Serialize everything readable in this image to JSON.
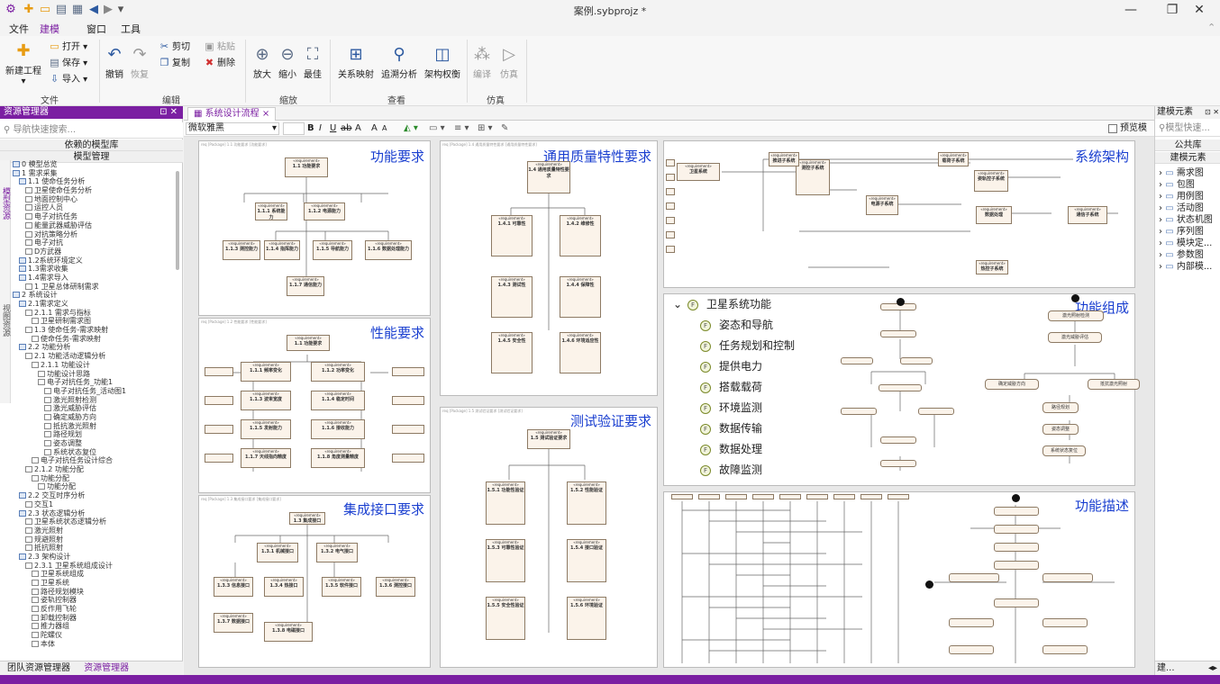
{
  "window": {
    "title": "案例.sybprojz *",
    "minimize": "—",
    "restore": "❐",
    "close": "✕"
  },
  "quickaccess": [
    "⚙",
    "✚",
    "▭",
    "▤",
    "▦",
    "◀",
    "▶",
    "▾"
  ],
  "menu": {
    "items": [
      "文件",
      "建模",
      "窗口",
      "工具"
    ],
    "active": "建模"
  },
  "ribbon": {
    "file_group": {
      "label": "文件",
      "new": "新建工程",
      "open": "打开",
      "save": "保存",
      "import": "导入"
    },
    "edit_group": {
      "label": "编辑",
      "undo": "撤销",
      "redo": "恢复",
      "cut": "剪切",
      "copy": "复制",
      "paste": "粘贴",
      "delete": "删除"
    },
    "zoom_group": {
      "label": "缩放",
      "zoomin": "放大",
      "zoomout": "缩小",
      "fit": "最佳"
    },
    "view_group": {
      "label": "查看",
      "relmap": "关系映射",
      "trace": "追溯分析",
      "tradeoff": "架构权衡"
    },
    "sim_group": {
      "label": "仿真",
      "compile": "编译",
      "simulate": "仿真"
    }
  },
  "left": {
    "title": "资源管理器",
    "search_placeholder": "导航快速搜索...",
    "header1": "依赖的模型库",
    "header2": "模型管理",
    "vtabs": [
      "模型资源",
      "视图资源"
    ],
    "tree": [
      {
        "d": 0,
        "t": "0 模型总览"
      },
      {
        "d": 0,
        "t": "1 需求采集"
      },
      {
        "d": 1,
        "t": "1.1 使命任务分析"
      },
      {
        "d": 2,
        "t": "卫星使命任务分析"
      },
      {
        "d": 2,
        "t": "地面控制中心"
      },
      {
        "d": 2,
        "t": "运控人员"
      },
      {
        "d": 2,
        "t": "电子对抗任务"
      },
      {
        "d": 2,
        "t": "能量武器威胁评估"
      },
      {
        "d": 2,
        "t": "对抗策略分析"
      },
      {
        "d": 2,
        "t": "电子对抗"
      },
      {
        "d": 2,
        "t": "D方武器"
      },
      {
        "d": 1,
        "t": "1.2系统环境定义"
      },
      {
        "d": 1,
        "t": "1.3需求收集"
      },
      {
        "d": 1,
        "t": "1.4需求导入"
      },
      {
        "d": 2,
        "t": "1 卫星总体研制需求"
      },
      {
        "d": 0,
        "t": "2 系统设计"
      },
      {
        "d": 1,
        "t": "2.1需求定义"
      },
      {
        "d": 2,
        "t": "2.1.1 需求与指标"
      },
      {
        "d": 3,
        "t": "卫星研制需求图"
      },
      {
        "d": 2,
        "t": "1.3 使命任务-需求映射"
      },
      {
        "d": 3,
        "t": "使命任务-需求映射"
      },
      {
        "d": 1,
        "t": "2.2 功能分析"
      },
      {
        "d": 2,
        "t": "2.1 功能活动逻辑分析"
      },
      {
        "d": 3,
        "t": "2.1.1 功能设计"
      },
      {
        "d": 4,
        "t": "功能设计思路"
      },
      {
        "d": 4,
        "t": "电子对抗任务_功能1"
      },
      {
        "d": 5,
        "t": "电子对抗任务_活动图1"
      },
      {
        "d": 5,
        "t": "激光照射检测"
      },
      {
        "d": 5,
        "t": "激光威胁评估"
      },
      {
        "d": 5,
        "t": "确定威胁方向"
      },
      {
        "d": 5,
        "t": "抵抗激光照射"
      },
      {
        "d": 5,
        "t": "路径规划"
      },
      {
        "d": 5,
        "t": "姿态调整"
      },
      {
        "d": 5,
        "t": "系统状态复位"
      },
      {
        "d": 3,
        "t": "电子对抗任务设计综合"
      },
      {
        "d": 2,
        "t": "2.1.2 功能分配"
      },
      {
        "d": 3,
        "t": "功能分配"
      },
      {
        "d": 4,
        "t": "功能分配"
      },
      {
        "d": 1,
        "t": "2.2 交互时序分析"
      },
      {
        "d": 2,
        "t": "交互1"
      },
      {
        "d": 1,
        "t": "2.3 状态逻辑分析"
      },
      {
        "d": 2,
        "t": "卫星系统状态逻辑分析"
      },
      {
        "d": 2,
        "t": "激光照射"
      },
      {
        "d": 2,
        "t": "规避照射"
      },
      {
        "d": 2,
        "t": "抵抗照射"
      },
      {
        "d": 1,
        "t": "2.3 架构设计"
      },
      {
        "d": 2,
        "t": "2.3.1 卫星系统组成设计"
      },
      {
        "d": 3,
        "t": "卫星系统组成"
      },
      {
        "d": 3,
        "t": "卫星系统"
      },
      {
        "d": 3,
        "t": "路径规划模块"
      },
      {
        "d": 3,
        "t": "姿轨控制器"
      },
      {
        "d": 3,
        "t": "反作用飞轮"
      },
      {
        "d": 3,
        "t": "卸载控制器"
      },
      {
        "d": 3,
        "t": "推力器组"
      },
      {
        "d": 3,
        "t": "陀螺仪"
      },
      {
        "d": 3,
        "t": "本体"
      }
    ],
    "bottom_tabs": [
      "团队资源管理器",
      "资源管理器"
    ]
  },
  "doc": {
    "tab": "系统设计流程",
    "font": "微软雅黑",
    "fmt": [
      "B",
      "I",
      "U",
      "ab",
      "A",
      "A",
      "A"
    ],
    "preview": "预览模式",
    "frames": {
      "f1": {
        "label": "功能要求",
        "hdr": "req [Package] 1.1 功能要求 [功能要求]"
      },
      "f2": {
        "label": "性能要求",
        "hdr": "req [Package] 1.2 性能要求 [性能要求]"
      },
      "f3": {
        "label": "集成接口要求",
        "hdr": "req [Package] 1.3 集成接口要求 [集成接口要求]"
      },
      "f4": {
        "label": "通用质量特性要求",
        "hdr": "req [Package] 1.4 通用质量特性要求 [通用质量特性要求]"
      },
      "f5": {
        "label": "测试验证要求",
        "hdr": "req [Package] 1.5 测试验证要求 [测试验证要求]"
      },
      "f6": {
        "label": "系统架构"
      },
      "f7": {
        "label": "功能组成"
      },
      "f8": {
        "label": "功能描述"
      }
    },
    "boxes_f1": [
      "1.1 功能要求",
      "1.1.1 系统能力",
      "1.1.2 电源能力",
      "1.1.3 测控能力",
      "1.1.4 指挥能力",
      "1.1.5 导航能力",
      "1.1.6 数据处理能力",
      "1.1.7 通信能力"
    ],
    "boxes_f2": [
      "1.1 功能要求",
      "1.1.1 频率变化",
      "1.1.2 功率变化",
      "1.1.3 波束宽度",
      "1.1.4 稳定时间",
      "1.1.5 发射能力",
      "1.1.6 接收能力",
      "1.1.7 天线指向精度",
      "1.1.8 角度测量精度"
    ],
    "boxes_f3": [
      "1.3 集成接口",
      "1.3.1 机械接口",
      "1.3.2 电气接口",
      "1.3.3 信息接口",
      "1.3.4 热接口",
      "1.3.5 软件接口",
      "1.3.6 测控接口",
      "1.3.7 数据接口",
      "1.3.8 电磁接口"
    ],
    "boxes_f4": [
      "1.4 通用质量特性要求",
      "1.4.1 可靠性",
      "1.4.2 维修性",
      "1.4.3 测试性",
      "1.4.4 保障性",
      "1.4.5 安全性",
      "1.4.6 环境适应性"
    ],
    "boxes_f5": [
      "1.5 测试验证要求",
      "1.5.1 功能性验证",
      "1.5.2 性能验证",
      "1.5.3 可靠性验证",
      "1.5.4 接口验证",
      "1.5.5 安全性验证",
      "1.5.6 环境验证"
    ],
    "boxes_f6": [
      "卫星系统",
      "测控子系统",
      "电源子系统",
      "姿轨控子系统",
      "数据处理",
      "通信子系统",
      "热控子系统",
      "推进子系统",
      "载荷子系统"
    ],
    "func_tree": [
      "卫星系统功能",
      "姿态和导航",
      "任务规划和控制",
      "提供电力",
      "搭载载荷",
      "环境监测",
      "数据传输",
      "数据处理",
      "故障监测"
    ],
    "act_f7": [
      "激光照射检测",
      "激光威胁评估",
      "确定威胁方向",
      "抵抗激光照射",
      "路径规划",
      "姿态调整",
      "系统状态复位"
    ]
  },
  "right": {
    "title": "建模元素",
    "search_placeholder": "模型快速...",
    "hdr1": "公共库",
    "hdr2": "建模元素",
    "items": [
      "需求图",
      "包图",
      "用例图",
      "活动图",
      "状态机图",
      "序列图",
      "模块定...",
      "参数图",
      "内部模..."
    ],
    "bottom": "建..."
  },
  "colors": {
    "accent": "#7b1fa2",
    "label": "#1a3fd0",
    "box": "#fbf3ea"
  }
}
